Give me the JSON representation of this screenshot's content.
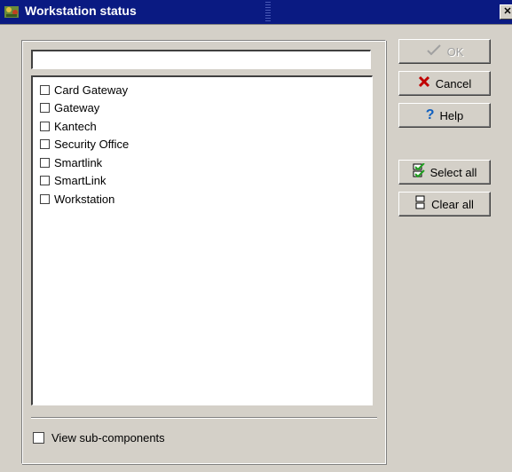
{
  "window": {
    "title": "Workstation status",
    "close_glyph": "✕"
  },
  "filter": {
    "value": ""
  },
  "list": {
    "items": [
      {
        "label": "Card Gateway",
        "checked": false
      },
      {
        "label": "Gateway",
        "checked": false
      },
      {
        "label": "Kantech",
        "checked": false
      },
      {
        "label": "Security Office",
        "checked": false
      },
      {
        "label": "Smartlink",
        "checked": false
      },
      {
        "label": "SmartLink",
        "checked": false
      },
      {
        "label": "Workstation",
        "checked": false
      }
    ]
  },
  "view_sub_components": {
    "label": "View sub-components",
    "checked": false
  },
  "buttons": {
    "ok": {
      "label": "OK",
      "icon": "check-icon",
      "enabled": false
    },
    "cancel": {
      "label": "Cancel",
      "icon": "x-icon",
      "color": "#c00000"
    },
    "help": {
      "label": "Help",
      "icon": "question-icon",
      "color": "#1060c0"
    },
    "select_all": {
      "label": "Select all",
      "icon": "select-all-icon",
      "color": "#20a020"
    },
    "clear_all": {
      "label": "Clear all",
      "icon": "clear-all-icon"
    }
  }
}
